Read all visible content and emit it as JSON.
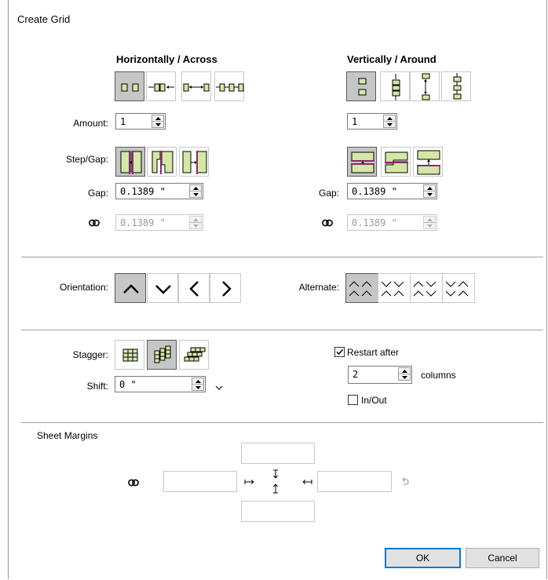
{
  "dialog": {
    "title": "Create Grid"
  },
  "horizontal": {
    "header": "Horizontally / Across",
    "amount_value": "1",
    "gap_value": "0.1389 \"",
    "linked_value": "0.1389 \""
  },
  "vertical": {
    "header": "Vertically / Around",
    "amount_value": "1",
    "gap_value": "0.1389 \"",
    "linked_value": "0.1389 \""
  },
  "labels": {
    "amount": "Amount:",
    "step_gap": "Step/Gap:",
    "gap": "Gap:",
    "gap_v": "Gap:",
    "orientation": "Orientation:",
    "alternate": "Alternate:",
    "stagger": "Stagger:",
    "shift": "Shift:",
    "sheet_margins": "Sheet Margins"
  },
  "stagger": {
    "shift_value": "0 \"",
    "restart_after_label": "Restart after",
    "restart_after_checked": true,
    "columns_value": "2",
    "columns_label": "columns",
    "in_out_label": "In/Out",
    "in_out_checked": false
  },
  "buttons": {
    "ok": "OK",
    "cancel": "Cancel"
  },
  "colors": {
    "tile_green": "#d4e7a7",
    "accent_purple": "#8b2a6e",
    "selected_bg": "#c6c6c6",
    "ok_border": "#0078d7"
  },
  "icons": {
    "link": "link-icon",
    "reset": "undo-icon",
    "margin_arrows": [
      "arrow-right-to-bar-icon",
      "arrow-vertical-inward-icon",
      "arrow-left-to-bar-icon"
    ]
  }
}
